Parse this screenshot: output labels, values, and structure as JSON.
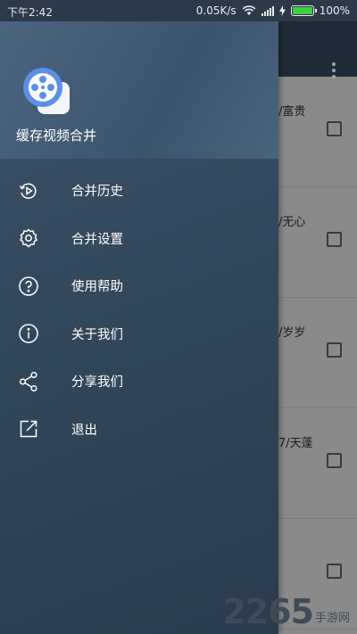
{
  "status_bar": {
    "time": "下午2:42",
    "net_speed": "0.05K/s",
    "battery_percent": "100%",
    "battery_level": 1.0
  },
  "drawer": {
    "app_name": "缓存视频合并",
    "menu": [
      {
        "label": "合并历史",
        "icon": "history-play-icon"
      },
      {
        "label": "合并设置",
        "icon": "gear-icon"
      },
      {
        "label": "使用帮助",
        "icon": "help-circle-icon"
      },
      {
        "label": "关于我们",
        "icon": "info-circle-icon"
      },
      {
        "label": "分享我们",
        "icon": "share-icon"
      },
      {
        "label": "退出",
        "icon": "exit-icon"
      }
    ]
  },
  "background_list": [
    {
      "text": "/富贵"
    },
    {
      "text": "/无心"
    },
    {
      "text": "/岁岁"
    },
    {
      "text": "7/天蓬"
    },
    {
      "text": ""
    }
  ],
  "watermark": {
    "number": "2265",
    "site": "手游网"
  },
  "colors": {
    "drawer_bg": "#34495d",
    "header_bg": "#4a6580",
    "battery": "#3fcf3f",
    "watermark_accent": "#e4532a"
  }
}
